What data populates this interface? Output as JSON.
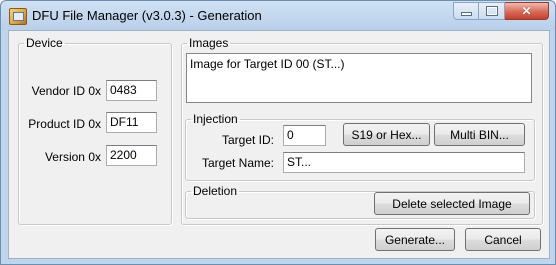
{
  "window": {
    "title": "DFU File Manager (v3.0.3) - Generation",
    "controls": {
      "minimize": "minimize-icon",
      "maximize": "maximize-icon",
      "close": "close-icon"
    }
  },
  "device": {
    "legend": "Device",
    "vendor_label": "Vendor ID 0x",
    "vendor_value": "0483",
    "product_label": "Product ID 0x",
    "product_value": "DF11",
    "version_label": "Version 0x",
    "version_value": "2200"
  },
  "images": {
    "legend": "Images",
    "items": [
      "Image for Target ID 00  (ST...)"
    ]
  },
  "injection": {
    "legend": "Injection",
    "target_id_label": "Target ID:",
    "target_id_value": "0",
    "s19_button": "S19 or Hex...",
    "multibin_button": "Multi BIN...",
    "target_name_label": "Target Name:",
    "target_name_value": "ST..."
  },
  "deletion": {
    "legend": "Deletion",
    "delete_button": "Delete selected Image"
  },
  "footer": {
    "generate_button": "Generate...",
    "cancel_button": "Cancel"
  },
  "colors": {
    "frame": "#bfd5ec",
    "client": "#f0f0f0",
    "close_button": "#c4412a"
  }
}
